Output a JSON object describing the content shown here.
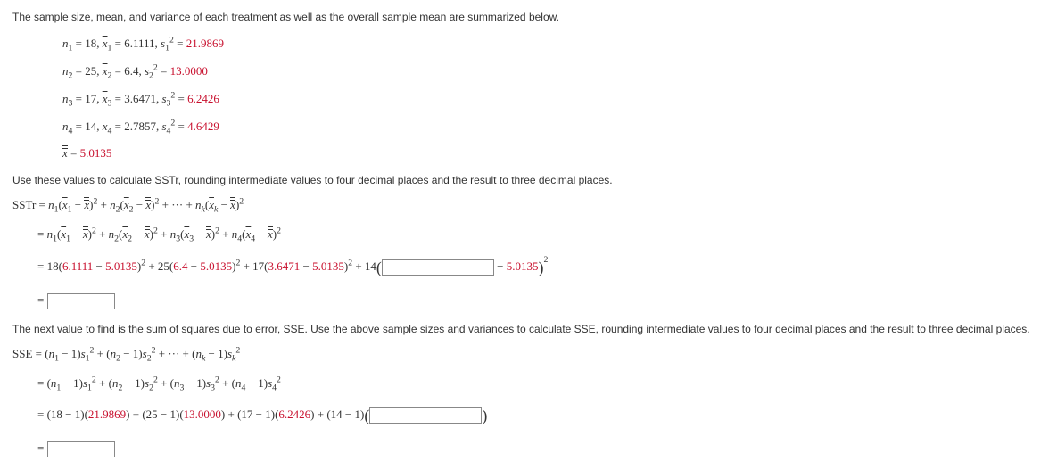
{
  "intro": "The sample size, mean, and variance of each treatment as well as the overall sample mean are summarized below.",
  "s1": {
    "n": "18",
    "mean": "6.1111",
    "var": "21.9869"
  },
  "s2": {
    "n": "25",
    "mean": "6.4",
    "var": "13.0000"
  },
  "s3": {
    "n": "17",
    "mean": "3.6471",
    "var": "6.2426"
  },
  "s4": {
    "n": "14",
    "mean": "2.7857",
    "var": "4.6429"
  },
  "grand": "5.0135",
  "sstr_intro": "Use these values to calculate SSTr, rounding intermediate values to four decimal places and the result to three decimal places.",
  "sse_intro": "The next value to find is the sum of squares due to error, SSE. Use the above sample sizes and variances to calculate SSE, rounding intermediate values to four decimal places and the result to three decimal places.",
  "nums": {
    "a1": "18",
    "m1": "6.1111",
    "g1": "5.0135",
    "a2": "25",
    "m2": "6.4",
    "g2": "5.0135",
    "a3": "17",
    "m3": "3.6471",
    "g3": "5.0135",
    "a4": "14",
    "g4": "5.0135"
  },
  "sse": {
    "c1a": "18",
    "c1b": "21.9869",
    "c2a": "25",
    "c2b": "13.0000",
    "c3a": "17",
    "c3b": "6.2426",
    "c4a": "14"
  }
}
